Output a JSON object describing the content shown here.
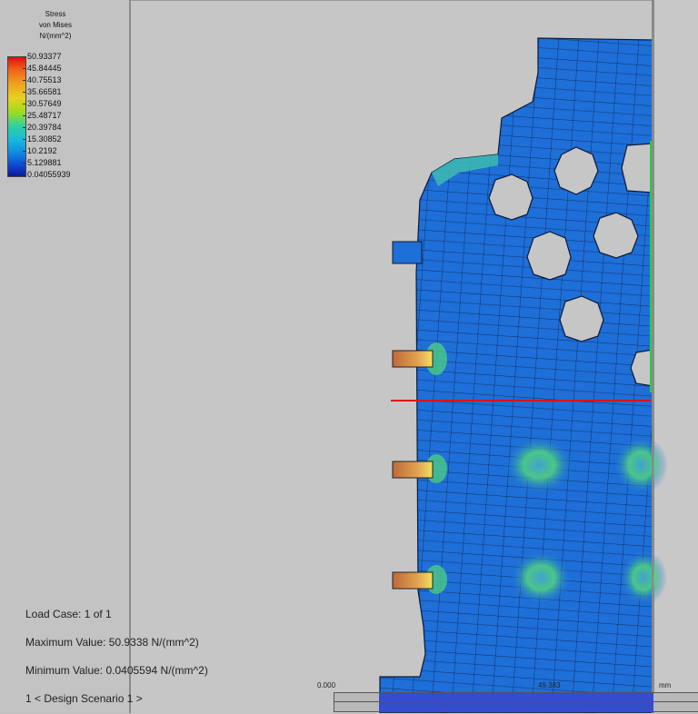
{
  "legend": {
    "title_line1": "Stress",
    "title_line2": "von Mises",
    "title_line3": "N/(mm^2)",
    "values": [
      "50.93377",
      "45.84445",
      "40.75513",
      "35.66581",
      "30.57649",
      "25.48717",
      "20.39784",
      "15.30852",
      "10.2192",
      "5.129881",
      "0.04055939"
    ]
  },
  "info": {
    "load_case": "Load Case:  1 of 1",
    "max_value": "Maximum Value: 50.9338 N/(mm^2)",
    "min_value": "Minimum Value: 0.0405594 N/(mm^2)",
    "design_scenario": "1 < Design Scenario 1 >"
  },
  "ruler": {
    "start": "0.000",
    "mid": "49.383",
    "unit": "mm"
  },
  "colors": {
    "mesh_blue": "#1e6fd8",
    "mesh_line": "#0a1a3a",
    "stress_high": "#e07030",
    "stress_mid": "#50d080",
    "section_line_red": "#e01010",
    "section_line_green": "#20d040"
  }
}
